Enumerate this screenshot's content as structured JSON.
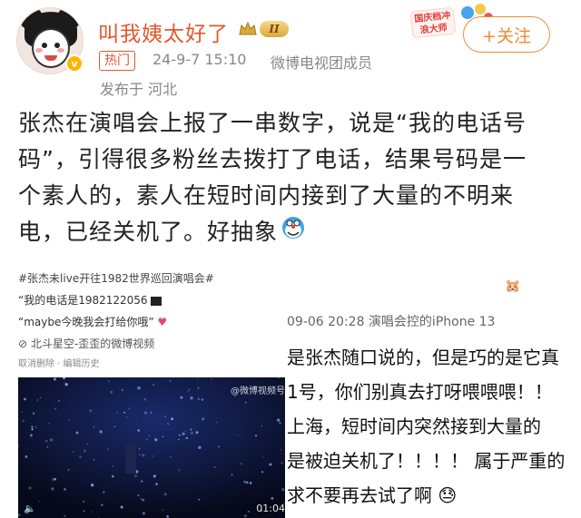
{
  "header": {
    "username": "叫我姨太好了",
    "vip_level": "II",
    "hot_tag": "热门",
    "time": "24-9-7 15:10",
    "source": "微博电视团成员",
    "location": "发布于 河北",
    "holiday_label": "国庆档冲浪大师",
    "follow_label": "+关注"
  },
  "post": {
    "text": "张杰在演唱会上报了一串数字，说是“我的电话号码”，引得很多粉丝去拨打了电话，结果号码是一个素人的，素人在短时间内接到了大量的不明来电，已经关机了。好抽象"
  },
  "embed_left": {
    "hashtag": "#张杰未live开往1982世界巡回演唱会#",
    "quote1": "“我的电话是1982122056",
    "quote2": "“maybe今晚我会打给你哦”",
    "source": "北斗星空-歪歪的微博视频",
    "actions": "取消删除  · 编辑历史",
    "watermark": "@微博视频号",
    "duration": "01:04"
  },
  "embed_right": {
    "timestamp": "09-06 20:28  演唱会控的iPhone 13",
    "lines": [
      "是张杰随口说的，但是巧的是它真",
      "1号，你们别真去打呀喂喂喂！！",
      "上海，短时间内突然接到大量的",
      "是被迫关机了！！！！ 属于严重的",
      "求不要再去试了啊"
    ]
  },
  "colors": {
    "accent_orange": "#f28a35",
    "username_red": "#e4572e",
    "meta_gray": "#888888"
  }
}
